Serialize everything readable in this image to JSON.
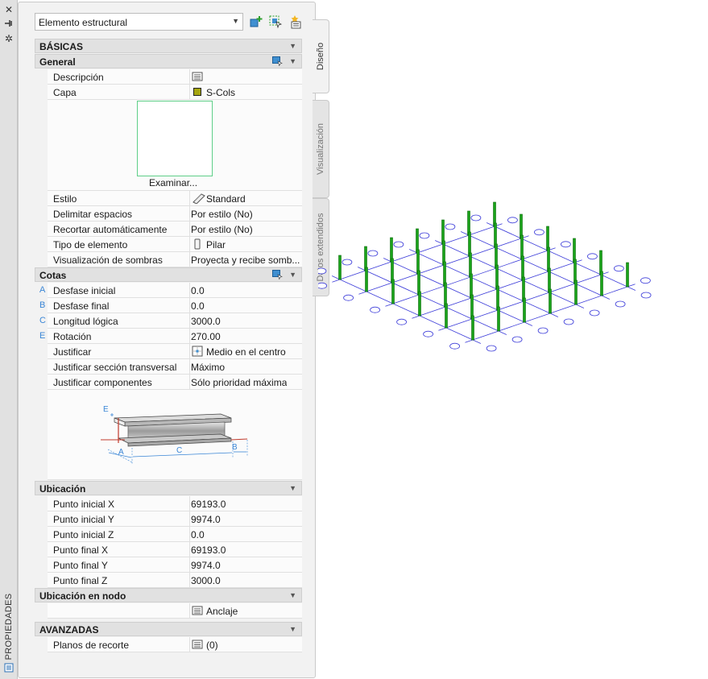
{
  "palette": {
    "title": "PROPIEDADES",
    "close_icon": "close-icon",
    "autohide_icon": "autohide-icon",
    "settings_icon": "gear-icon"
  },
  "tabs": [
    {
      "label": "Diseño",
      "active": true
    },
    {
      "label": "Visualización",
      "active": false
    },
    {
      "label": "Datos extendidos",
      "active": false
    }
  ],
  "selector": {
    "value": "Elemento estructural"
  },
  "toolbar": {
    "add_icon": "add-selection-icon",
    "select_icon": "select-objects-icon",
    "quick_select_icon": "quick-select-icon"
  },
  "sections": {
    "basicas": "BÁSICAS",
    "general": "General",
    "cotas": "Cotas",
    "ubicacion": "Ubicación",
    "ubicacion_nodo": "Ubicación en nodo",
    "avanzadas": "AVANZADAS"
  },
  "general": {
    "descripcion": {
      "label": "Descripción",
      "value": ""
    },
    "capa": {
      "label": "Capa",
      "value": "S-Cols",
      "color": "#a5a50f"
    },
    "examinar": "Examinar...",
    "estilo": {
      "label": "Estilo",
      "value": "Standard"
    },
    "delimitar": {
      "label": "Delimitar espacios",
      "value": "Por estilo (No)"
    },
    "recortar": {
      "label": "Recortar automáticamente",
      "value": "Por estilo (No)"
    },
    "tipo": {
      "label": "Tipo de elemento",
      "value": "Pilar"
    },
    "sombras": {
      "label": "Visualización de sombras",
      "value": "Proyecta y recibe somb..."
    }
  },
  "cotas": {
    "desfase_inicial": {
      "letter": "A",
      "label": "Desfase inicial",
      "value": "0.0"
    },
    "desfase_final": {
      "letter": "B",
      "label": "Desfase final",
      "value": "0.0"
    },
    "longitud": {
      "letter": "C",
      "label": "Longitud lógica",
      "value": "3000.0"
    },
    "rotacion": {
      "letter": "E",
      "label": "Rotación",
      "value": "270.00"
    },
    "justificar": {
      "label": "Justificar",
      "value": "Medio en el centro"
    },
    "justificar_seccion": {
      "label": "Justificar sección transversal",
      "value": "Máximo"
    },
    "justificar_comp": {
      "label": "Justificar componentes",
      "value": "Sólo prioridad máxima"
    },
    "diagram": {
      "e": "E",
      "a": "A",
      "c": "C",
      "b": "B"
    }
  },
  "ubicacion": {
    "pix": {
      "label": "Punto inicial X",
      "value": "69193.0"
    },
    "piy": {
      "label": "Punto inicial Y",
      "value": "9974.0"
    },
    "piz": {
      "label": "Punto inicial Z",
      "value": "0.0"
    },
    "pfx": {
      "label": "Punto final X",
      "value": "69193.0"
    },
    "pfy": {
      "label": "Punto final Y",
      "value": "9974.0"
    },
    "pfz": {
      "label": "Punto final Z",
      "value": "3000.0"
    }
  },
  "ubicacion_nodo": {
    "anclaje": "Anclaje"
  },
  "avanzadas": {
    "planos": {
      "label": "Planos de recorte",
      "value": "(0)"
    }
  },
  "colors": {
    "grid": "#3b3bd9",
    "column": "#1aa31a",
    "column_dark": "#0b6b0b",
    "bubble": "#3b3bd9"
  }
}
